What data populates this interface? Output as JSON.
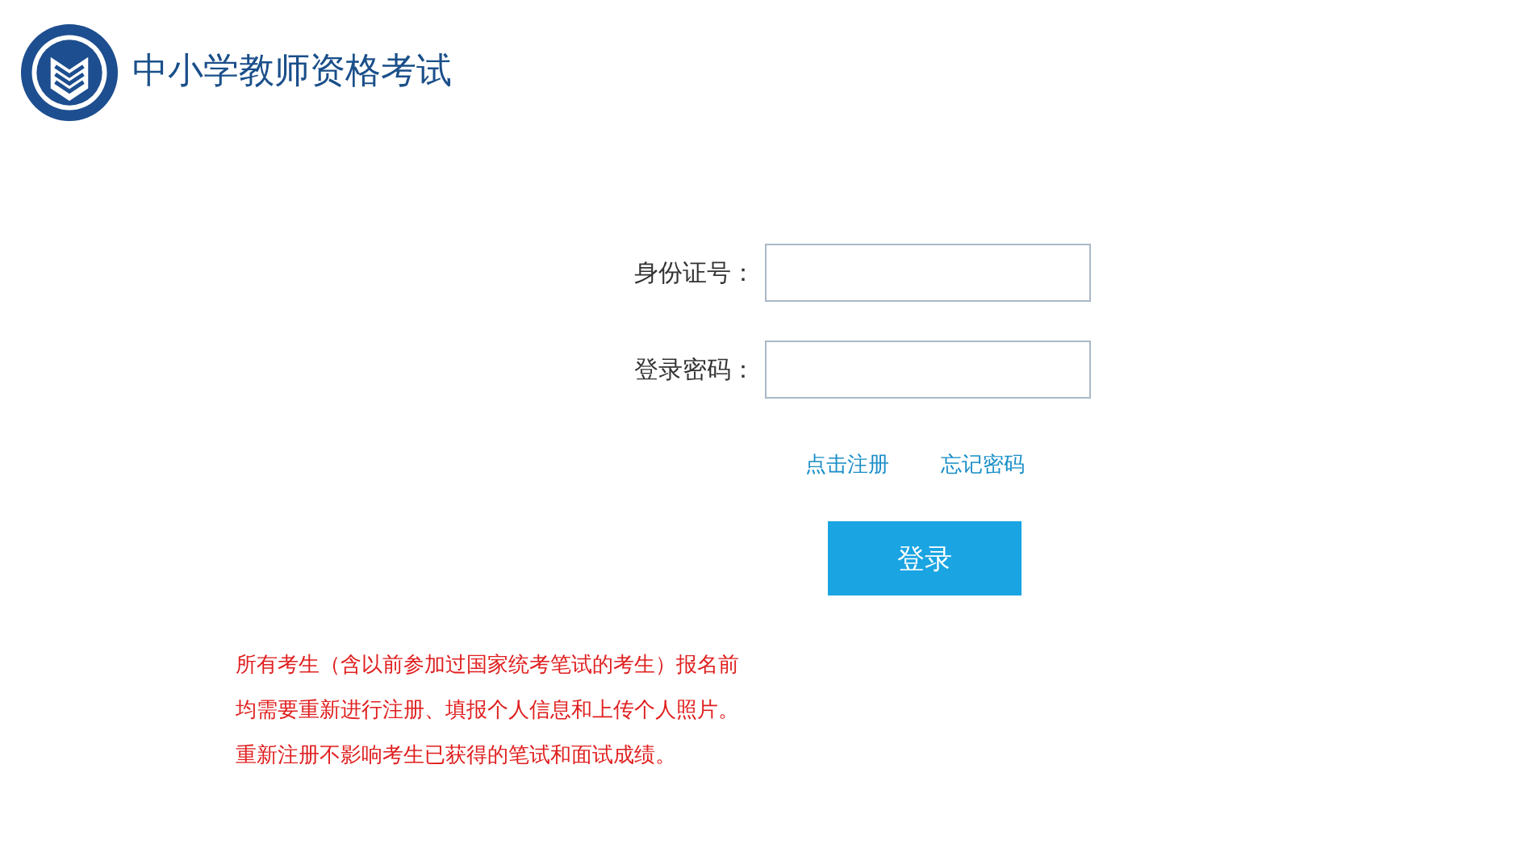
{
  "header": {
    "title": "中小学教师资格考试"
  },
  "form": {
    "fields": [
      {
        "label": "身份证号："
      },
      {
        "label": "登录密码："
      }
    ],
    "links": [
      "点击注册",
      "忘记密码"
    ],
    "submit": "登录"
  },
  "notice": [
    "所有考生（含以前参加过国家统考笔试的考生）报名前",
    "均需要重新进行注册、填报个人信息和上传个人照片。",
    "重新注册不影响考生已获得的笔试和面试成绩。"
  ]
}
